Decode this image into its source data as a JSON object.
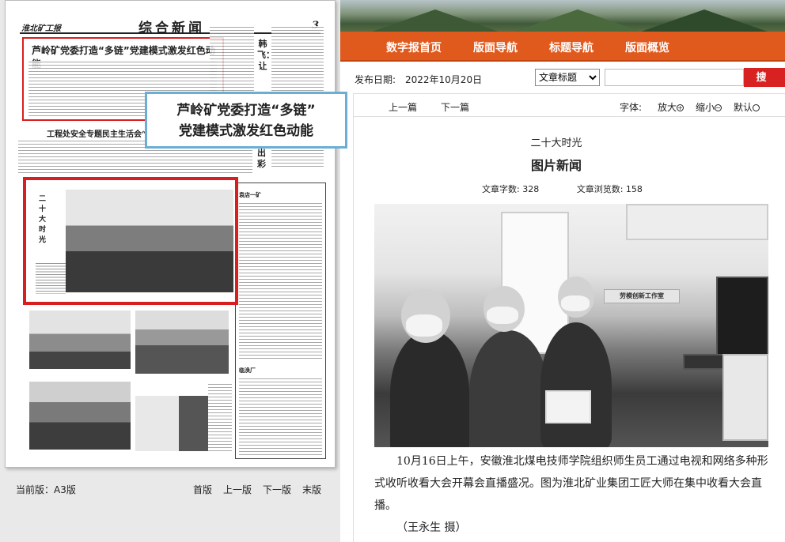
{
  "epaper": {
    "masthead_paper": "淮北矿工报",
    "masthead_section": "综合新闻",
    "page_number": "3",
    "headline_1": "芦岭矿党委打造“多链”党建模式激发红色动能",
    "headline_2": "工程处安全专题民主生活会“准”",
    "vertical_head": "韩飞：让",
    "vertical_head_2": "出彩",
    "photo_vertical_title": "二十大时光",
    "box_kicker_1": "袁店一矿",
    "box_kicker_2": "临涣厂",
    "tooltip_line1": "芦岭矿党委打造“多链”",
    "tooltip_line2": "党建模式激发红色动能"
  },
  "page_footer": {
    "current_label": "当前版：A3版",
    "first": "首版",
    "prev": "上一版",
    "next": "下一版",
    "last": "末版"
  },
  "nav": {
    "items": [
      "数字报首页",
      "版面导航",
      "标题导航",
      "版面概览"
    ]
  },
  "search": {
    "date_label": "发布日期:",
    "date_value": "2022年10月20日",
    "select_value": "文章标题",
    "input_value": "",
    "button_label": "搜 索"
  },
  "toolbar": {
    "prev_article": "上一篇",
    "next_article": "下一篇",
    "font_label": "字体:",
    "enlarge": "放大",
    "shrink": "缩小",
    "default": "默认"
  },
  "article": {
    "kicker": "二十大时光",
    "title": "图片新闻",
    "word_count": "文章字数: 328",
    "view_count": "文章浏览数: 158",
    "photo_sign": "劳模创新工作室",
    "body": "10月16日上午，安徽淮北煤电技师学院组织师生员工通过电视和网络多种形式收听收看大会开幕会直播盛况。图为淮北矿业集团工匠大师在集中收看大会直播。",
    "credit": "（王永生 摄）"
  },
  "colors": {
    "nav_bg": "#e05a1e",
    "highlight_red": "#d81e1e",
    "tooltip_border": "#6aaed6",
    "search_button": "#d82222"
  }
}
